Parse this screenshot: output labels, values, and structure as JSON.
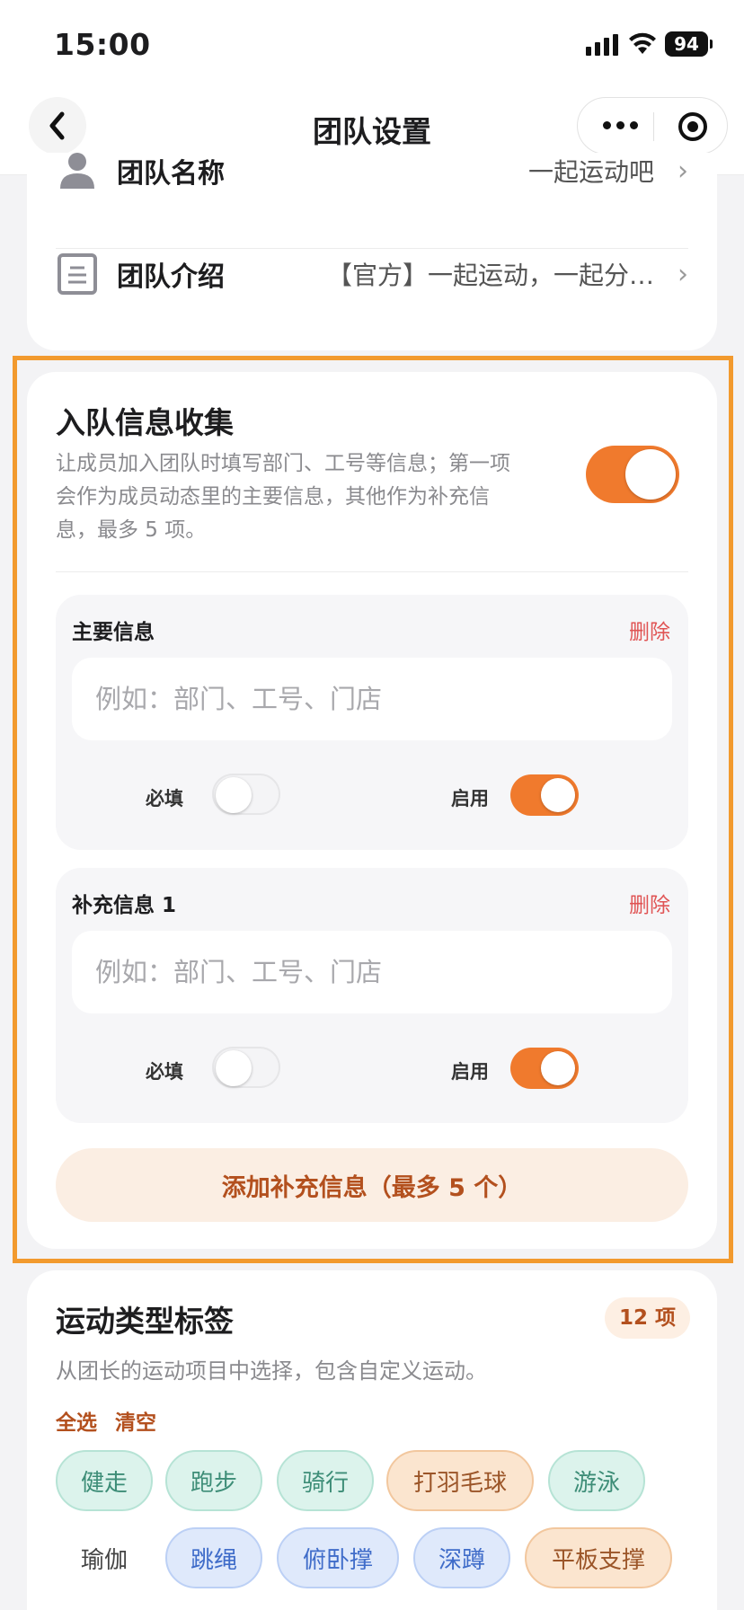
{
  "status_bar": {
    "time": "15:00",
    "battery": "94",
    "signal_icon": "cellular-signal-icon",
    "wifi_icon": "wifi-icon"
  },
  "nav": {
    "back_icon": "chevron-left-icon",
    "title": "团队设置",
    "more_icon": "more-dots-icon",
    "close_icon": "target-icon"
  },
  "team_info": {
    "name_label": "团队名称",
    "name_value": "一起运动吧",
    "intro_label": "团队介绍",
    "intro_value": "【官方】一起运动，一起分…",
    "chevron": "›"
  },
  "join_info": {
    "title": "入队信息收集",
    "description": "让成员加入团队时填写部门、工号等信息；第一项会作为成员动态里的主要信息，其他作为补充信息，最多 5 项。",
    "enabled": true,
    "fields": [
      {
        "title": "主要信息",
        "delete_label": "删除",
        "placeholder": "例如：部门、工号、门店",
        "required_label": "必填",
        "required": false,
        "enabled_label": "启用",
        "enabled": true
      },
      {
        "title": "补充信息 1",
        "delete_label": "删除",
        "placeholder": "例如：部门、工号、门店",
        "required_label": "必填",
        "required": false,
        "enabled_label": "启用",
        "enabled": true
      }
    ],
    "add_button_label": "添加补充信息（最多 5 个）"
  },
  "sport_tags": {
    "title": "运动类型标签",
    "count": "12 项",
    "description": "从团长的运动项目中选择，包含自定义运动。",
    "select_all": "全选",
    "clear": "清空",
    "tags": [
      {
        "label": "健走",
        "style": "mint"
      },
      {
        "label": "跑步",
        "style": "mint"
      },
      {
        "label": "骑行",
        "style": "mint"
      },
      {
        "label": "打羽毛球",
        "style": "peach"
      },
      {
        "label": "游泳",
        "style": "mint"
      },
      {
        "label": "瑜伽",
        "style": "gray"
      },
      {
        "label": "跳绳",
        "style": "blue"
      },
      {
        "label": "俯卧撑",
        "style": "blue"
      },
      {
        "label": "深蹲",
        "style": "blue"
      },
      {
        "label": "平板支撑",
        "style": "peach"
      }
    ]
  },
  "colors": {
    "accent": "#f07a2d",
    "highlight_frame": "#f29a2e",
    "delete": "#e05454",
    "add_button_text": "#b3501e"
  }
}
